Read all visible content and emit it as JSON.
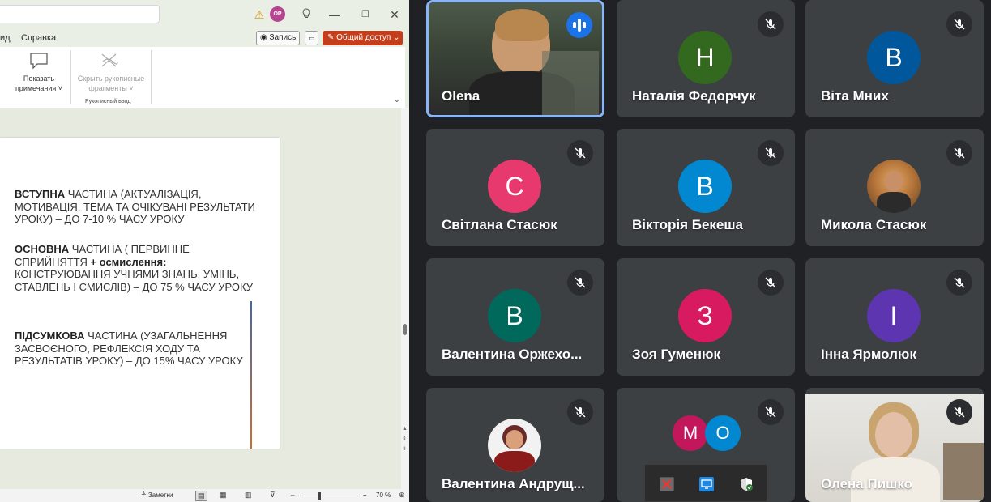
{
  "ppt": {
    "menu": {
      "item_partial": "ид",
      "help": "Справка"
    },
    "titlebar": {
      "warning_icon": "warning-icon",
      "avatar_initials": "OP",
      "light_icon": "lightbulb-icon",
      "minimize": "—",
      "maximize": "❐",
      "close": "✕"
    },
    "buttons": {
      "record": "◉ Запись",
      "share": "✎ Общий доступ ⌄"
    },
    "ribbon": {
      "show_notes_line1": "Показать",
      "show_notes_line2": "примечания ˅",
      "hide_ink_line1": "Скрыть рукописные",
      "hide_ink_line2": "фрагменты ˅",
      "group_caption": "Рукописный ввод"
    },
    "slide": {
      "para1_bold": "ВСТУПНА",
      "para1_rest": " ЧАСТИНА (АКТУАЛІЗАЦІЯ, МОТИВАЦІЯ, ТЕМА ТА ОЧІКУВАНІ РЕЗУЛЬТАТИ УРОКУ) – ДО 7-10 % ЧАСУ УРОКУ",
      "para2_bold": "ОСНОВНА",
      "para2_rest": " ЧАСТИНА ( ПЕРВИННЕ СПРИЙНЯТТЯ ",
      "para2_plus": "+ осмислення:",
      "para2_tail": " КОНСТРУЮВАННЯ УЧНЯМИ ЗНАНЬ, УМІНЬ, СТАВЛЕНЬ І СМИСЛІВ) – ДО 75 % ЧАСУ УРОКУ",
      "para3_bold": "ПІДСУМКОВА",
      "para3_rest": " ЧАСТИНА (УЗАГАЛЬНЕННЯ ЗАСВОЄНОГО, РЕФЛЕКСІЯ ХОДУ ТА РЕЗУЛЬТАТІВ УРОКУ) – ДО 15% ЧАСУ УРОКУ"
    },
    "status": {
      "notes": "≜ Заметки",
      "zoom_minus": "–",
      "zoom_plus": "+",
      "zoom": "70 %"
    }
  },
  "meet": {
    "participants": [
      {
        "name": "Olena",
        "state": "speaking",
        "kind": "photo"
      },
      {
        "name": "Наталія Федорчук",
        "initial": "Н",
        "color": "#33691e",
        "state": "muted"
      },
      {
        "name": "Віта Мних",
        "initial": "В",
        "color": "#01579b",
        "state": "muted"
      },
      {
        "name": "Світлана Стасюк",
        "initial": "С",
        "color": "#e8396f",
        "state": "muted"
      },
      {
        "name": "Вікторія Бекеша",
        "initial": "В",
        "color": "#0288d1",
        "state": "muted"
      },
      {
        "name": "Микола Стасюк",
        "state": "muted",
        "kind": "photo"
      },
      {
        "name": "Валентина Оржехо...",
        "initial": "В",
        "color": "#00695c",
        "state": "muted"
      },
      {
        "name": "Зоя Гуменюк",
        "initial": "З",
        "color": "#d81b60",
        "state": "muted"
      },
      {
        "name": "Інна Ярмолюк",
        "initial": "І",
        "color": "#5e35b1",
        "state": "muted"
      },
      {
        "name": "Валентина Андрущ...",
        "state": "muted",
        "kind": "photo"
      },
      {
        "initials": [
          "М",
          "О"
        ],
        "colors": [
          "#c2185b",
          "#0288d1"
        ],
        "state": "muted"
      },
      {
        "name": "Олена Пишко",
        "state": "muted",
        "kind": "video"
      }
    ]
  }
}
